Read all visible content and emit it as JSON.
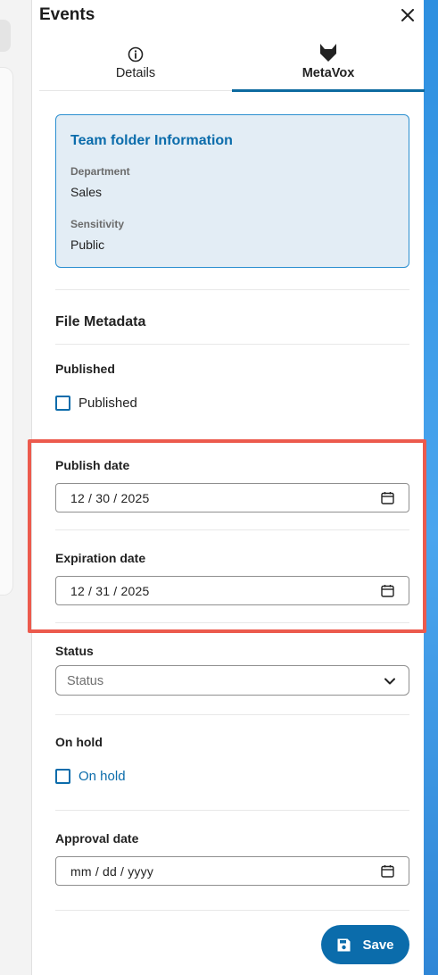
{
  "header": {
    "title": "Events"
  },
  "tabs": [
    {
      "label": "Details",
      "icon": "info-icon"
    },
    {
      "label": "MetaVox",
      "icon": "fox-icon",
      "active": true
    }
  ],
  "team_folder": {
    "title": "Team folder Information",
    "fields": [
      {
        "label": "Department",
        "value": "Sales"
      },
      {
        "label": "Sensitivity",
        "value": "Public"
      }
    ]
  },
  "file_metadata": {
    "title": "File Metadata",
    "published": {
      "label": "Published",
      "checkbox_label": "Published",
      "checked": false
    },
    "publish_date": {
      "label": "Publish date",
      "value": "12 / 30 / 2025"
    },
    "expiration_date": {
      "label": "Expiration date",
      "value": "12 / 31 / 2025"
    },
    "status": {
      "label": "Status",
      "placeholder": "Status"
    },
    "on_hold": {
      "label": "On hold",
      "checkbox_label": "On hold",
      "checked": false
    },
    "approval_date": {
      "label": "Approval date",
      "value": "mm / dd / yyyy"
    }
  },
  "actions": {
    "save_label": "Save"
  },
  "colors": {
    "primary": "#0b6cab",
    "info_bg": "#e3edf5",
    "highlight": "#ec5a4d"
  }
}
